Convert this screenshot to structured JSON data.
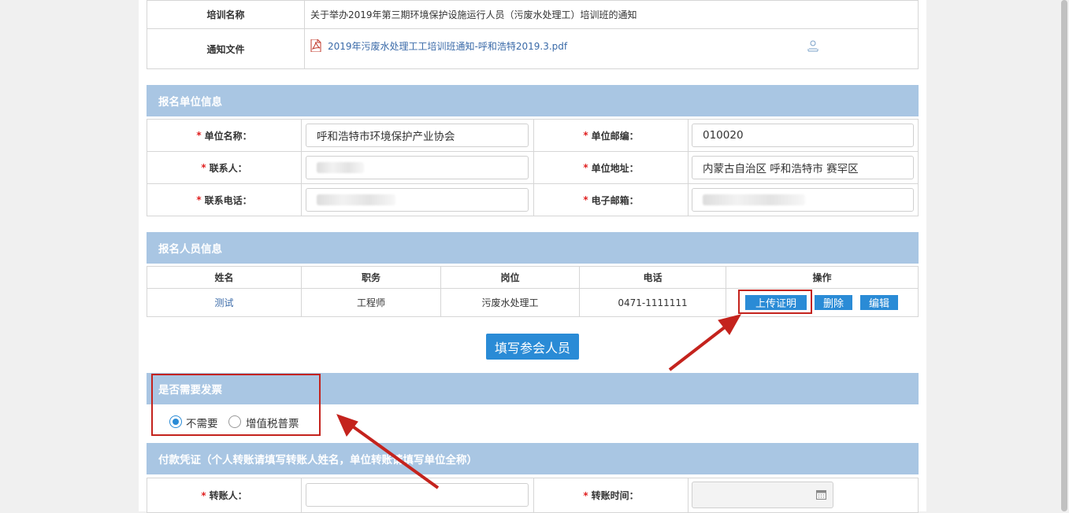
{
  "notice": {
    "name_label": "培训名称",
    "name_value": "关于举办2019年第三期环境保护设施运行人员（污废水处理工）培训班的通知",
    "file_label": "通知文件",
    "file_link": "2019年污废水处理工工培训班通知-呼和浩特2019.3.pdf"
  },
  "unit_section": {
    "title": "报名单位信息",
    "unit_name_label": "单位名称：",
    "unit_name_value": "呼和浩特市环境保护产业协会",
    "postcode_label": "单位邮编：",
    "postcode_value": "010020",
    "contact_label": "联系人：",
    "address_label": "单位地址：",
    "address_value": "内蒙古自治区 呼和浩特市 赛罕区",
    "phone_label": "联系电话：",
    "email_label": "电子邮箱："
  },
  "people_section": {
    "title": "报名人员信息",
    "headers": [
      "姓名",
      "职务",
      "岗位",
      "电话",
      "操作"
    ],
    "rows": [
      {
        "name": "测试",
        "title": "工程师",
        "post": "污废水处理工",
        "phone": "0471-1111111"
      }
    ],
    "upload_label": "上传证明",
    "delete_label": "删除",
    "edit_label": "编辑",
    "fill_button": "填写参会人员"
  },
  "invoice_section": {
    "title": "是否需要发票",
    "option_no": "不需要",
    "option_vat": "增值税普票",
    "selected": "不需要"
  },
  "payment_section": {
    "title": "付款凭证（个人转账请填写转账人姓名，单位转账请填写单位全称）",
    "payer_label": "转账人：",
    "time_label": "转账时间："
  },
  "colors": {
    "section_header": "#a9c6e3",
    "button_blue": "#2a8bd6",
    "annotation_red": "#c4231d",
    "link_blue": "#3a6aa8"
  }
}
